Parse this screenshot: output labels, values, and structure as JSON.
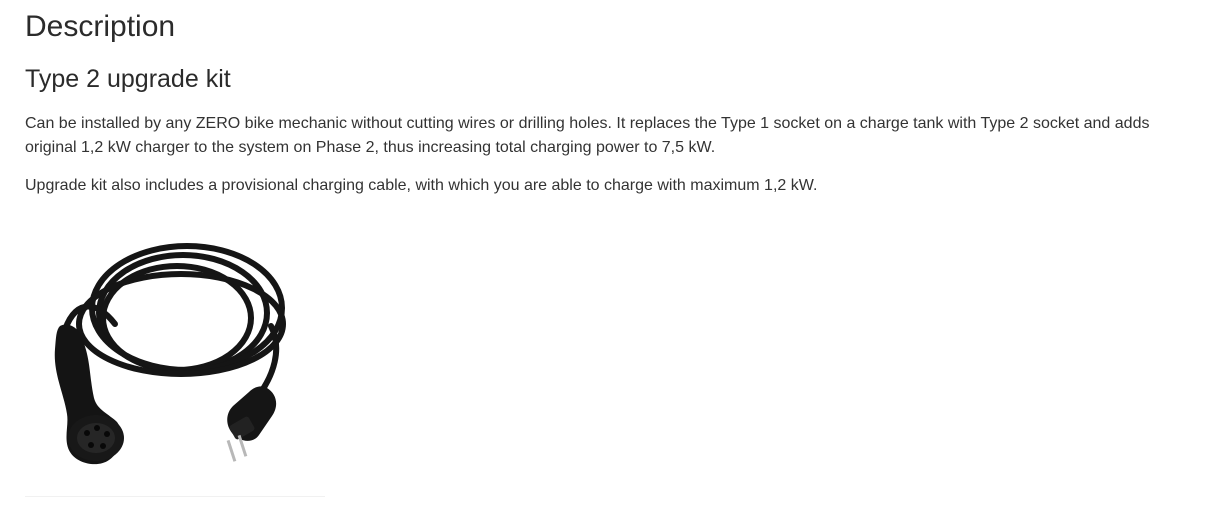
{
  "description": {
    "heading": "Description",
    "product_title": "Type 2 upgrade kit",
    "paragraphs": [
      "Can be installed by any ZERO bike mechanic without cutting wires or drilling holes. It replaces the Type 1 socket on a charge tank with Type 2 socket and adds original 1,2 kW charger to the system on Phase 2, thus increasing total charging power to 7,5 kW.",
      "Upgrade kit also includes a provisional charging cable, with which you are able to charge with maximum 1,2 kW."
    ]
  },
  "product_image": {
    "icon": "charging-cable-image"
  },
  "colors": {
    "text": "#333333",
    "heading": "#2b2b2b",
    "cable": "#151515"
  }
}
